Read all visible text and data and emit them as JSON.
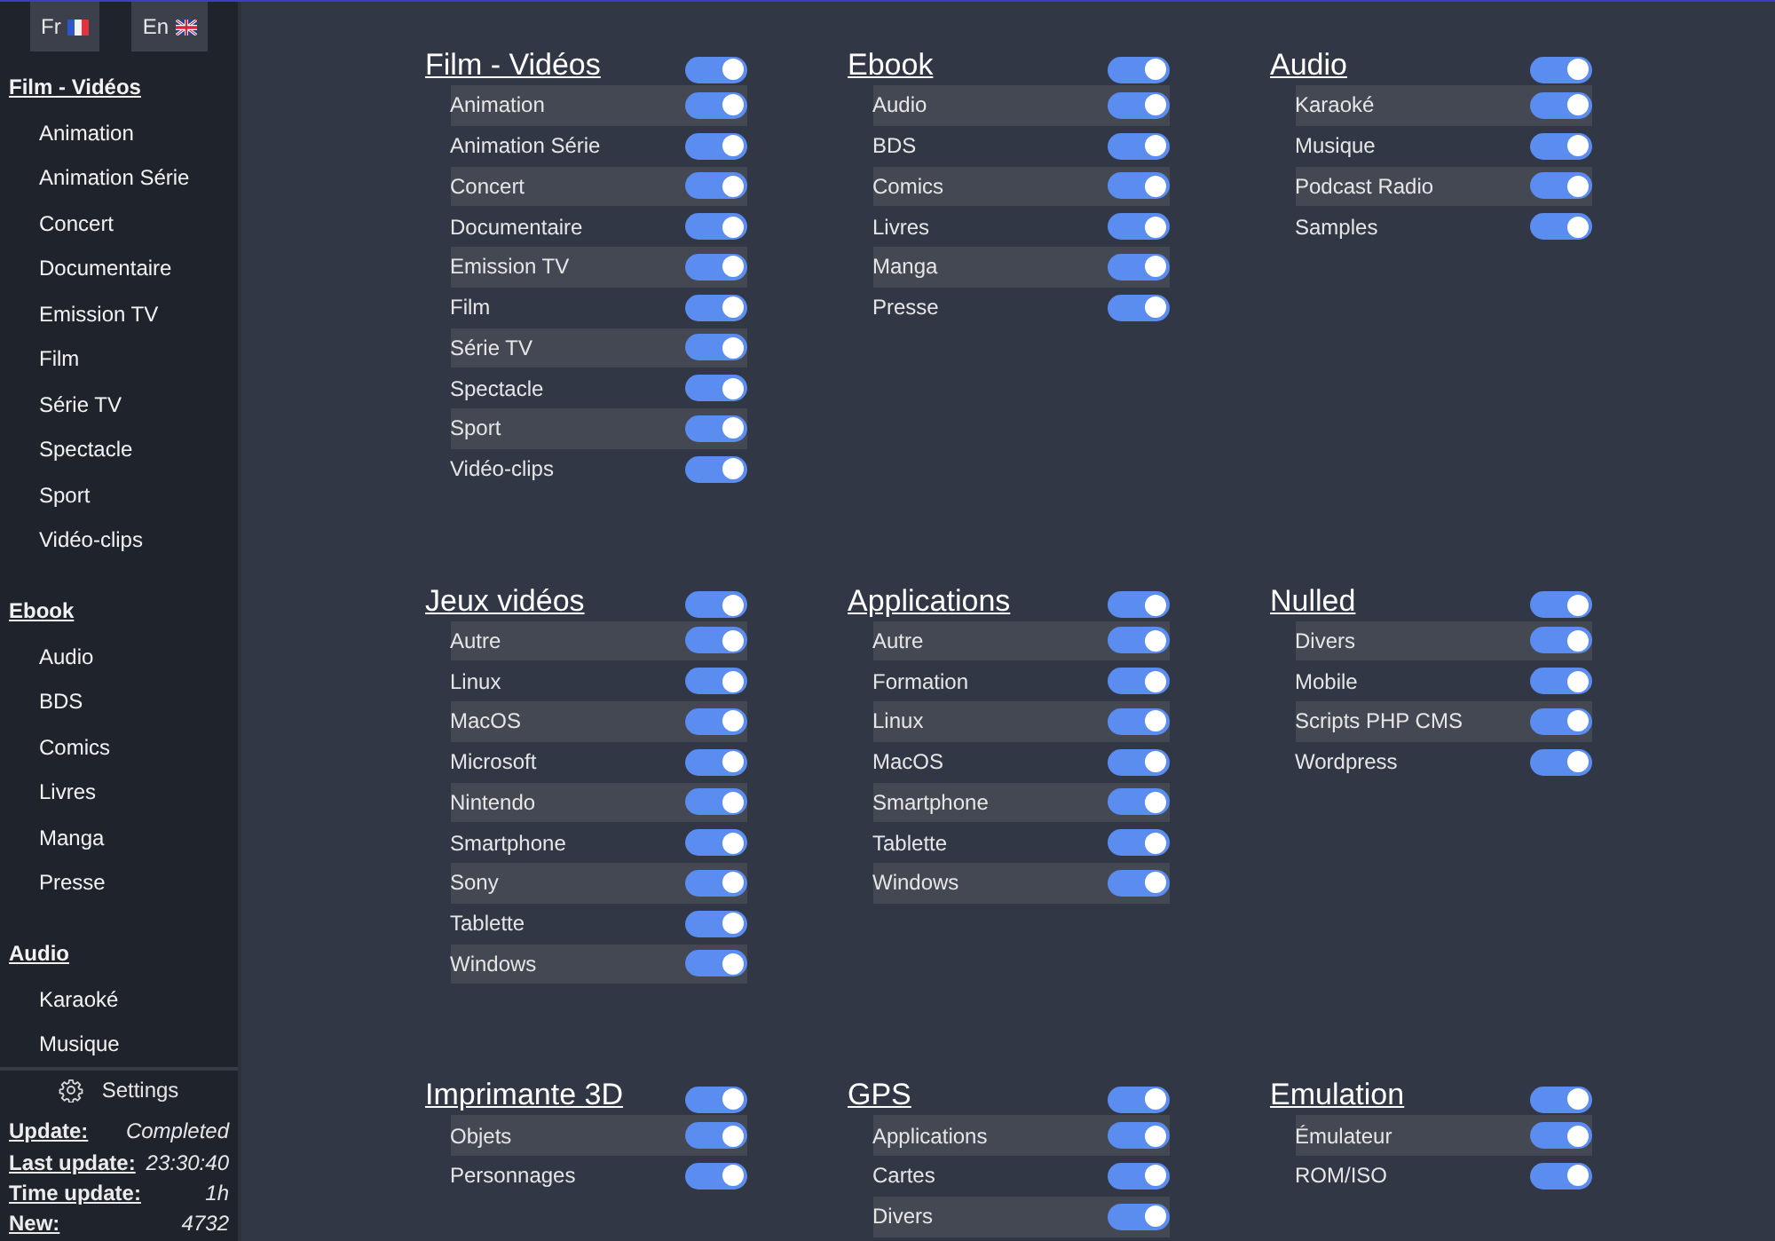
{
  "language_buttons": [
    {
      "label": "Fr",
      "kind": "french"
    },
    {
      "label": "En",
      "kind": "english"
    }
  ],
  "sidebar": {
    "sections": [
      {
        "title": "Film - Vidéos",
        "items": [
          "Animation",
          "Animation Série",
          "Concert",
          "Documentaire",
          "Emission TV",
          "Film",
          "Série TV",
          "Spectacle",
          "Sport",
          "Vidéo-clips"
        ]
      },
      {
        "title": "Ebook",
        "items": [
          "Audio",
          "BDS",
          "Comics",
          "Livres",
          "Manga",
          "Presse"
        ]
      },
      {
        "title": "Audio",
        "items": [
          "Karaoké",
          "Musique"
        ]
      }
    ],
    "settings": "Settings",
    "status": [
      {
        "label": "Update:",
        "value": "Completed"
      },
      {
        "label": "Last update:",
        "value": "23:30:40"
      },
      {
        "label": "Time update:",
        "value": "1h"
      },
      {
        "label": "New:",
        "value": "4732"
      }
    ]
  },
  "groups": [
    {
      "title": "Film - Vidéos",
      "on": true,
      "items": [
        {
          "label": "Animation",
          "on": true
        },
        {
          "label": "Animation Série",
          "on": true
        },
        {
          "label": "Concert",
          "on": true
        },
        {
          "label": "Documentaire",
          "on": true
        },
        {
          "label": "Emission TV",
          "on": true
        },
        {
          "label": "Film",
          "on": true
        },
        {
          "label": "Série TV",
          "on": true
        },
        {
          "label": "Spectacle",
          "on": true
        },
        {
          "label": "Sport",
          "on": true
        },
        {
          "label": "Vidéo-clips",
          "on": true
        }
      ]
    },
    {
      "title": "Ebook",
      "on": true,
      "items": [
        {
          "label": "Audio",
          "on": true
        },
        {
          "label": "BDS",
          "on": true
        },
        {
          "label": "Comics",
          "on": true
        },
        {
          "label": "Livres",
          "on": true
        },
        {
          "label": "Manga",
          "on": true
        },
        {
          "label": "Presse",
          "on": true
        }
      ]
    },
    {
      "title": "Audio",
      "on": true,
      "items": [
        {
          "label": "Karaoké",
          "on": true
        },
        {
          "label": "Musique",
          "on": true
        },
        {
          "label": "Podcast Radio",
          "on": true
        },
        {
          "label": "Samples",
          "on": true
        }
      ]
    },
    {
      "title": "Jeux vidéos",
      "on": true,
      "items": [
        {
          "label": "Autre",
          "on": true
        },
        {
          "label": "Linux",
          "on": true
        },
        {
          "label": "MacOS",
          "on": true
        },
        {
          "label": "Microsoft",
          "on": true
        },
        {
          "label": "Nintendo",
          "on": true
        },
        {
          "label": "Smartphone",
          "on": true
        },
        {
          "label": "Sony",
          "on": true
        },
        {
          "label": "Tablette",
          "on": true
        },
        {
          "label": "Windows",
          "on": true
        }
      ]
    },
    {
      "title": "Applications",
      "on": true,
      "items": [
        {
          "label": "Autre",
          "on": true
        },
        {
          "label": "Formation",
          "on": true
        },
        {
          "label": "Linux",
          "on": true
        },
        {
          "label": "MacOS",
          "on": true
        },
        {
          "label": "Smartphone",
          "on": true
        },
        {
          "label": "Tablette",
          "on": true
        },
        {
          "label": "Windows",
          "on": true
        }
      ]
    },
    {
      "title": "Nulled",
      "on": true,
      "items": [
        {
          "label": "Divers",
          "on": true
        },
        {
          "label": "Mobile",
          "on": true
        },
        {
          "label": "Scripts PHP CMS",
          "on": true
        },
        {
          "label": "Wordpress",
          "on": true
        }
      ]
    },
    {
      "title": "Imprimante 3D",
      "on": true,
      "items": [
        {
          "label": "Objets",
          "on": true
        },
        {
          "label": "Personnages",
          "on": true
        }
      ]
    },
    {
      "title": "GPS",
      "on": true,
      "items": [
        {
          "label": "Applications",
          "on": true
        },
        {
          "label": "Cartes",
          "on": true
        },
        {
          "label": "Divers",
          "on": true
        }
      ]
    },
    {
      "title": "Emulation",
      "on": true,
      "items": [
        {
          "label": "Émulateur",
          "on": true
        },
        {
          "label": "ROM/ISO",
          "on": true
        }
      ]
    }
  ]
}
